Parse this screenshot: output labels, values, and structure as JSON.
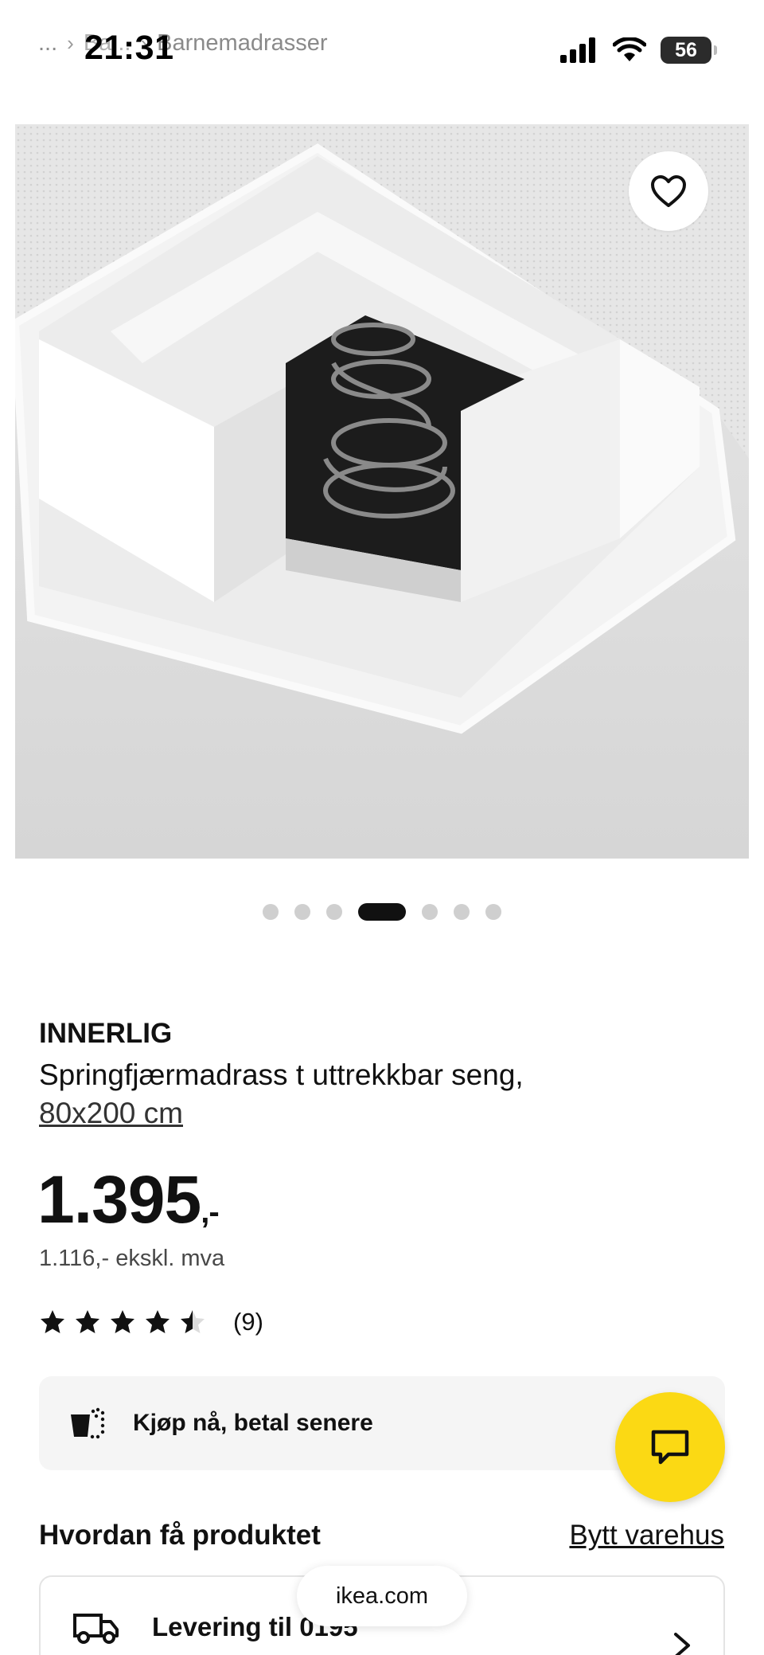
{
  "status_bar": {
    "time": "21:31",
    "battery": "56"
  },
  "breadcrumb": {
    "ellipsis": "...",
    "item_hidden": "Ba...",
    "current": "Barnemadrasser"
  },
  "product": {
    "name": "INNERLIG",
    "description": "Springfjærmadrass t uttrekkbar seng,",
    "size": "80x200 cm",
    "price_main": "1.395",
    "price_suffix": ",-",
    "price_ex_vat": "1.116,- ekskl. mva",
    "rating_value": 4.5,
    "rating_count": "(9)"
  },
  "carousel": {
    "total": 7,
    "active_index": 3
  },
  "pay_later": {
    "label": "Kjøp nå, betal senere"
  },
  "fulfilment": {
    "title": "Hvordan få produktet",
    "change_store": "Bytt varehus",
    "delivery_label": "Levering til 0195"
  },
  "browser": {
    "url": "ikea.com"
  },
  "icons": {
    "favourite": "heart-outline-icon",
    "chat": "chat-bubble-icon",
    "pay_later": "cart-dotted-icon",
    "delivery": "truck-icon",
    "chevron": "chevron-right-icon"
  },
  "colors": {
    "accent_yellow": "#fbd914",
    "card_bg": "#f5f5f5",
    "text": "#111111"
  }
}
